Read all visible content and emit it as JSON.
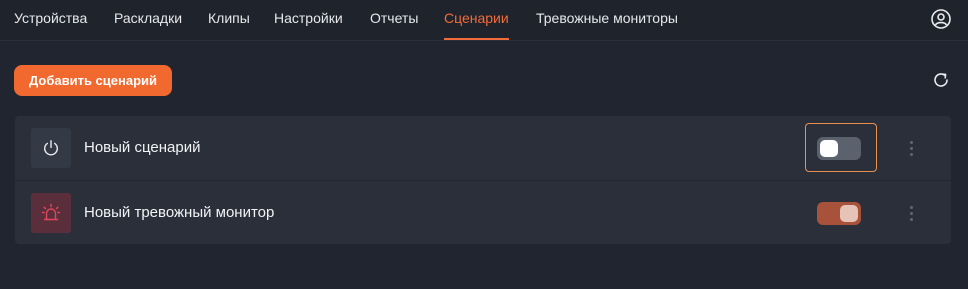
{
  "nav": {
    "items": [
      {
        "label": "Устройства"
      },
      {
        "label": "Раскладки"
      },
      {
        "label": "Клипы"
      },
      {
        "label": "Настройки"
      },
      {
        "label": "Отчеты"
      },
      {
        "label": "Сценарии",
        "active": true
      },
      {
        "label": "Тревожные мониторы"
      }
    ],
    "profile_icon": "user-circle-icon"
  },
  "toolbar": {
    "add_label": "Добавить сценарий",
    "refresh_icon": "refresh-icon"
  },
  "colors": {
    "accent": "#f26b3a",
    "background": "#1f232c",
    "row_background": "#2a2f3a",
    "alarm_icon": "#e0475d"
  },
  "rows": [
    {
      "title": "Новый сценарий",
      "icon": "power-icon",
      "enabled": false,
      "focused": true
    },
    {
      "title": "Новый тревожный монитор",
      "icon": "alarm-siren-icon",
      "enabled": true,
      "focused": false
    }
  ]
}
